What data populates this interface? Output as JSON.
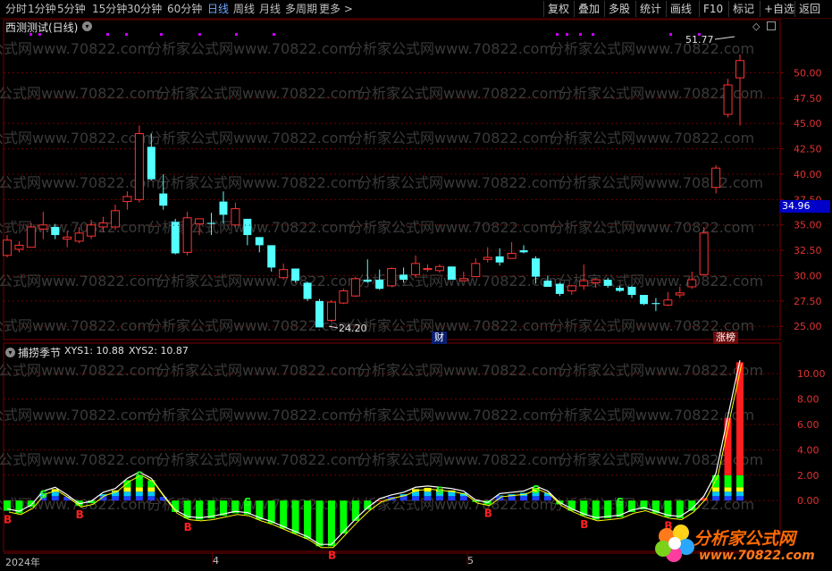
{
  "toolbar": {
    "periods": [
      "分时",
      "1分钟",
      "5分钟",
      "15分钟",
      "30分钟",
      "60分钟",
      "日线",
      "周线",
      "月线",
      "多周期",
      "更多 >"
    ],
    "active_period": "日线",
    "right_buttons": [
      "复权",
      "叠加",
      "多股",
      "统计",
      "画线",
      "F10",
      "标记",
      "+自选",
      "返回"
    ]
  },
  "main_panel": {
    "title": "西测测试(日线)",
    "high_label": "51.77",
    "low_label": "24.20",
    "current_price": "34.96",
    "tag_cai": "财",
    "tag_zhangbang": "涨榜",
    "y_ticks": [
      "50.00",
      "47.50",
      "45.00",
      "42.50",
      "40.00",
      "37.50",
      "35.00",
      "32.50",
      "30.00",
      "27.50",
      "25.00"
    ],
    "watermark": "分析家公式网www.70822.com"
  },
  "indicator_panel": {
    "title": "捕捞季节",
    "xys1": "XYS1: 10.88",
    "xys2": "XYS2: 10.87",
    "y_ticks": [
      "10.00",
      "8.00",
      "6.00",
      "4.00",
      "2.00",
      "0.00"
    ]
  },
  "x_axis": {
    "labels": [
      "2024年",
      "4",
      "5"
    ]
  },
  "logo": {
    "text": "分析家公式网",
    "url": "www.70822.com"
  },
  "colors": {
    "up": "#ff3232",
    "down": "#54ffff",
    "bar_green": "#00ff00",
    "bar_red": "#ff1e1e",
    "grid": "#6e0000",
    "active_tab": "#6fa8ff"
  },
  "chart_data": {
    "type": "candlestick",
    "candles": [
      [
        32.0,
        33.5,
        34.0,
        31.8
      ],
      [
        32.6,
        33.0,
        33.4,
        32.3
      ],
      [
        32.8,
        34.8,
        35.2,
        32.8
      ],
      [
        34.6,
        35.0,
        36.3,
        33.6
      ],
      [
        34.8,
        34.0,
        35.1,
        33.6
      ],
      [
        33.6,
        33.8,
        34.4,
        32.8
      ],
      [
        33.4,
        34.2,
        34.8,
        33.2
      ],
      [
        33.9,
        35.0,
        35.5,
        33.6
      ],
      [
        34.8,
        35.2,
        35.8,
        34.3
      ],
      [
        34.8,
        36.4,
        37.0,
        34.5
      ],
      [
        37.3,
        37.8,
        38.3,
        36.5
      ],
      [
        37.5,
        44.0,
        44.8,
        37.2
      ],
      [
        42.7,
        39.5,
        44.0,
        39.4
      ],
      [
        38.1,
        36.9,
        40.0,
        36.5
      ],
      [
        35.3,
        32.2,
        35.6,
        32.1
      ],
      [
        32.3,
        35.7,
        36.3,
        32.0
      ],
      [
        35.1,
        35.6,
        35.6,
        34.0
      ],
      [
        35.2,
        35.1,
        36.2,
        34.0
      ],
      [
        37.3,
        36.0,
        38.3,
        35.1
      ],
      [
        35.0,
        36.6,
        37.2,
        34.8
      ],
      [
        35.6,
        34.0,
        35.6,
        33.0
      ],
      [
        33.8,
        33.0,
        33.8,
        32.3
      ],
      [
        33.0,
        30.8,
        33.0,
        30.4
      ],
      [
        29.8,
        30.6,
        31.2,
        29.6
      ],
      [
        30.7,
        29.5,
        30.7,
        29.3
      ],
      [
        29.3,
        27.7,
        29.4,
        27.5
      ],
      [
        27.5,
        24.9,
        27.7,
        24.9
      ],
      [
        25.6,
        27.4,
        27.6,
        25.4
      ],
      [
        27.3,
        28.5,
        28.7,
        27.2
      ],
      [
        28.0,
        29.7,
        29.9,
        27.9
      ],
      [
        29.6,
        29.4,
        31.6,
        29.3
      ],
      [
        29.6,
        28.7,
        30.6,
        28.6
      ],
      [
        29.0,
        30.7,
        30.8,
        28.9
      ],
      [
        30.1,
        29.6,
        30.8,
        29.3
      ],
      [
        30.1,
        31.2,
        32.0,
        29.8
      ],
      [
        30.6,
        30.7,
        31.1,
        30.4
      ],
      [
        30.5,
        30.9,
        31.1,
        30.3
      ],
      [
        30.9,
        29.6,
        30.9,
        29.6
      ],
      [
        29.5,
        29.7,
        30.4,
        29.6
      ],
      [
        29.9,
        31.2,
        31.7,
        29.9
      ],
      [
        31.6,
        31.8,
        32.8,
        31.3
      ],
      [
        31.9,
        31.3,
        32.7,
        31.0
      ],
      [
        31.7,
        32.2,
        33.3,
        31.7
      ],
      [
        32.5,
        32.3,
        33.0,
        32.2
      ],
      [
        31.7,
        29.9,
        31.9,
        29.2
      ],
      [
        29.5,
        28.9,
        30.0,
        28.9
      ],
      [
        29.2,
        28.2,
        29.3,
        28.0
      ],
      [
        28.5,
        29.0,
        29.1,
        28.1
      ],
      [
        29.0,
        29.5,
        31.1,
        28.6
      ],
      [
        29.3,
        29.6,
        29.8,
        28.8
      ],
      [
        29.6,
        29.0,
        29.8,
        28.8
      ],
      [
        28.8,
        28.5,
        29.0,
        28.4
      ],
      [
        28.9,
        28.1,
        29.0,
        27.8
      ],
      [
        28.1,
        27.2,
        28.1,
        27.1
      ],
      [
        27.3,
        27.2,
        27.8,
        26.5
      ],
      [
        27.1,
        27.6,
        28.4,
        27.0
      ],
      [
        28.1,
        28.3,
        28.9,
        27.8
      ],
      [
        28.9,
        29.6,
        30.4,
        28.7
      ],
      [
        30.1,
        34.2,
        34.8,
        30.0
      ],
      [
        38.7,
        40.6,
        40.9,
        38.1
      ],
      [
        45.9,
        48.8,
        49.4,
        45.6
      ],
      [
        49.5,
        51.2,
        51.8,
        44.8
      ]
    ],
    "hist": [
      -0.8,
      -1.0,
      -0.5,
      0.6,
      0.9,
      0.3,
      -0.4,
      -0.2,
      0.5,
      0.8,
      1.6,
      2.1,
      1.6,
      0.3,
      -0.9,
      -1.4,
      -1.5,
      -1.4,
      -1.2,
      -1.0,
      -1.1,
      -1.5,
      -1.8,
      -2.2,
      -2.6,
      -3.0,
      -3.6,
      -3.6,
      -2.6,
      -1.6,
      -0.7,
      0.0,
      0.3,
      0.5,
      0.9,
      1.0,
      0.9,
      0.8,
      0.6,
      -0.1,
      -0.3,
      0.4,
      0.5,
      0.6,
      1.0,
      0.6,
      -0.3,
      -0.8,
      -1.2,
      -1.5,
      -1.4,
      -1.3,
      -0.9,
      -0.7,
      -1.0,
      -1.3,
      -1.4,
      -0.8,
      0.2,
      2.0,
      6.5,
      10.9
    ],
    "signals": [
      [
        0,
        "B"
      ],
      [
        3,
        "S"
      ],
      [
        6,
        "B"
      ],
      [
        11,
        "S"
      ],
      [
        15,
        "B"
      ],
      [
        20,
        "S"
      ],
      [
        27,
        "B"
      ],
      [
        36,
        "S"
      ],
      [
        40,
        "B"
      ],
      [
        44,
        "S"
      ],
      [
        48,
        "B"
      ],
      [
        51,
        "S"
      ],
      [
        55,
        "B"
      ]
    ],
    "price_range": [
      23.7,
      54.0
    ],
    "ind_range": [
      -4.0,
      11.7
    ]
  }
}
